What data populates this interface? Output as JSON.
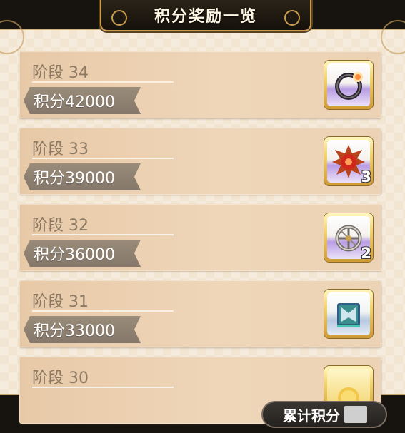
{
  "header": {
    "title": "积分奖励一览"
  },
  "rows": [
    {
      "stage": "阶段 34",
      "points": "积分42000",
      "reward_icon": "dark-ring-icon",
      "quantity": ""
    },
    {
      "stage": "阶段 33",
      "points": "积分39000",
      "reward_icon": "flame-orb-icon",
      "quantity": "3"
    },
    {
      "stage": "阶段 32",
      "points": "积分36000",
      "reward_icon": "silver-wheel-icon",
      "quantity": "2"
    },
    {
      "stage": "阶段 31",
      "points": "积分33000",
      "reward_icon": "spellbook-icon",
      "quantity": ""
    },
    {
      "stage": "阶段 30",
      "points": "",
      "reward_icon": "gold-coin-icon",
      "quantity": ""
    }
  ],
  "footer": {
    "label": "累计积分"
  },
  "colors": {
    "panel": "#f2e6d3",
    "row": "#ecd3b5",
    "pill": "#8f8171",
    "gold": "#c99b4d"
  }
}
